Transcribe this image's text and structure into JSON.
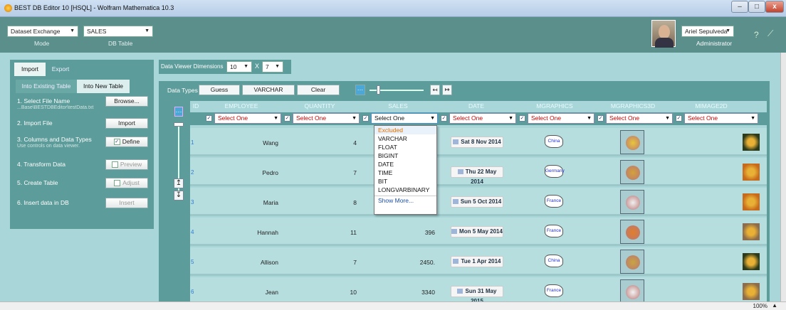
{
  "window": {
    "title": "BEST DB Editor 10 [HSQL] - Wolfram Mathematica 10.3",
    "min": "–",
    "max": "□",
    "close": "x"
  },
  "header": {
    "mode_value": "Dataset Exchange",
    "mode_caption": "Mode",
    "table_value": "SALES",
    "table_caption": "DB Table",
    "user_name": "Ariel Sepulveda",
    "user_role": "Administrator"
  },
  "tabs": {
    "import": "Import",
    "export": "Export",
    "into_existing": "Into Existing Table",
    "into_new": "Into New Table"
  },
  "steps": [
    {
      "label": "1. Select File Name",
      "sub": "...Base\\BESTDBEditor\\testData.txt",
      "button": "Browse..."
    },
    {
      "label": "2. Import File",
      "button": "Import"
    },
    {
      "label": "3. Columns and Data Types",
      "sub": "Use controls on data viewer.",
      "button": "Define"
    },
    {
      "label": "4. Transform Data",
      "button": "Preview"
    },
    {
      "label": "5. Create Table",
      "button": "Adjust"
    },
    {
      "label": "6. Insert data in DB",
      "button": "Insert"
    }
  ],
  "viewer": {
    "label": "Data Viewer Dimensions",
    "rows": "10",
    "x": "X",
    "cols": "7"
  },
  "datatypes": {
    "label": "Data Types",
    "guess": "Guess",
    "varchar": "VARCHAR",
    "clear": "Clear",
    "dots": "···",
    "left": "↤",
    "right": "↦"
  },
  "table": {
    "columns": [
      "ID",
      "EMPLOYEE",
      "QUANTITY",
      "SALES",
      "DATE",
      "MGRAPHICS",
      "MGRAPHICS3D",
      "MIMAGE2D"
    ],
    "select_one": "Select One",
    "rows": [
      {
        "id": "1",
        "employee": "Wang",
        "quantity": "4",
        "sales": "",
        "date": "Sat 8 Nov 2014",
        "map": "China"
      },
      {
        "id": "2",
        "employee": "Pedro",
        "quantity": "7",
        "sales": "",
        "date": "Thu 22 May 2014",
        "map": "Germany"
      },
      {
        "id": "3",
        "employee": "Maria",
        "quantity": "8",
        "sales": "",
        "date": "Sun 5 Oct 2014",
        "map": "France"
      },
      {
        "id": "4",
        "employee": "Hannah",
        "quantity": "11",
        "sales": "396",
        "date": "Mon 5 May 2014",
        "map": "France"
      },
      {
        "id": "5",
        "employee": "Allison",
        "quantity": "7",
        "sales": "2450.",
        "date": "Tue 1 Apr 2014",
        "map": "China"
      },
      {
        "id": "6",
        "employee": "Jean",
        "quantity": "10",
        "sales": "3340",
        "date": "Sun 31 May 2015",
        "map": "France"
      }
    ]
  },
  "dropdown": {
    "items": [
      "Excluded",
      "VARCHAR",
      "FLOAT",
      "BIGINT",
      "DATE",
      "TIME",
      "BIT",
      "LONGVARBINARY"
    ],
    "more": "Show More..."
  },
  "status": {
    "zoom": "100%"
  },
  "icons": {
    "arrow_up": "↥",
    "arrow_down": "↧"
  },
  "colors": {
    "header": "#5a8f8c",
    "panel": "#5c9c9a",
    "canvas": "#a9d7d9",
    "id_link": "#2e7bd2"
  }
}
